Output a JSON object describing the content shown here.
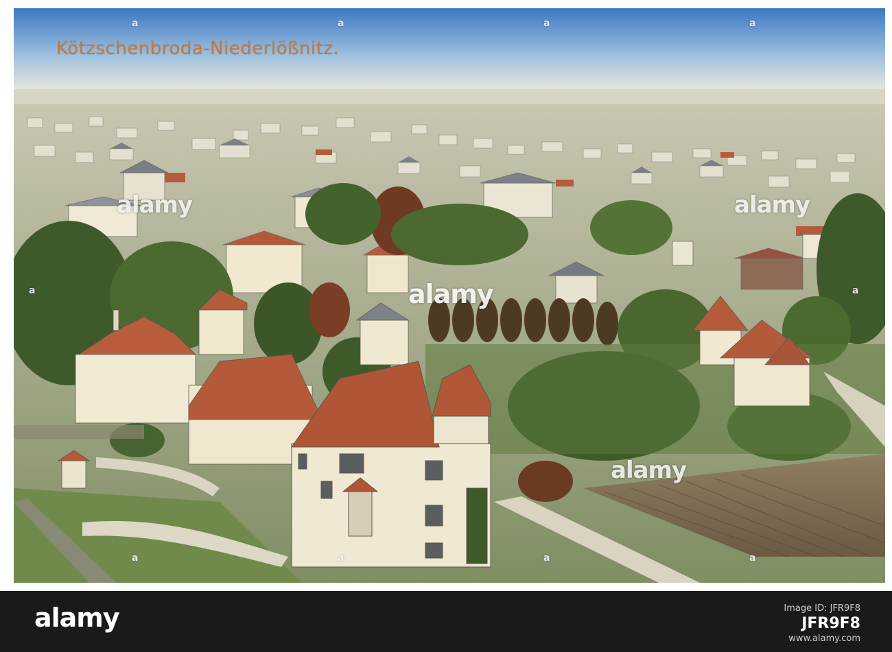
{
  "postcard": {
    "title": "Kötzschenbroda-Niederlößnitz."
  },
  "watermark": {
    "center_text": "alamy",
    "side_text": "alamy",
    "corner_letter": "a"
  },
  "footer": {
    "logo": "alamy",
    "image_id_label": "Image ID: JFR9F8",
    "image_id": "JFR9F8",
    "url": "www.alamy.com"
  },
  "colors": {
    "title": "#c9793a",
    "footer_bg": "#1a1a1a",
    "sky_top": "#3f7fc8",
    "sky_bottom": "#f0ecd8"
  }
}
